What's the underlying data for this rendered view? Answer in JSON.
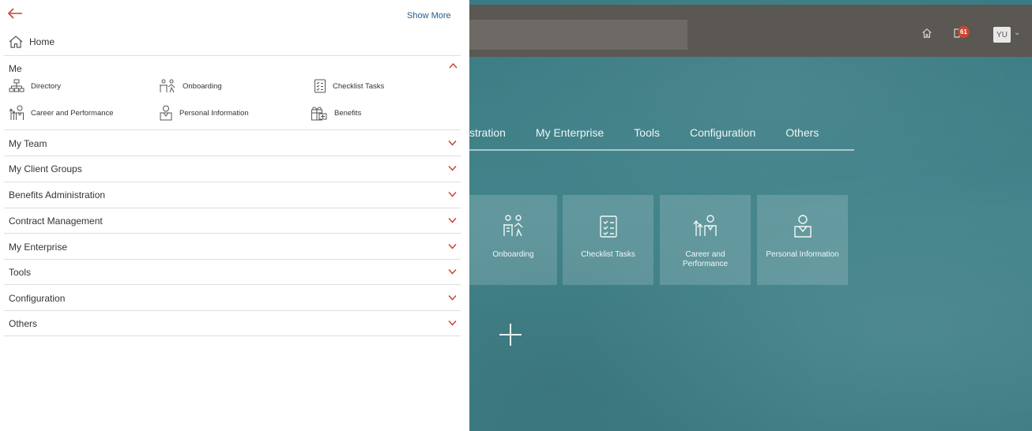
{
  "colors": {
    "accent": "#c74634",
    "link": "#1f5b8c",
    "topbar": "#5b5753",
    "background": "#3f7f86"
  },
  "drawer": {
    "back_icon": "arrow-left-icon",
    "show_more": "Show More",
    "home": {
      "label": "Home",
      "icon": "home-icon"
    },
    "me": {
      "title": "Me",
      "expanded": true,
      "items": [
        {
          "label": "Directory",
          "icon": "org-chart-icon"
        },
        {
          "label": "Onboarding",
          "icon": "onboarding-icon"
        },
        {
          "label": "Checklist Tasks",
          "icon": "checklist-icon"
        },
        {
          "label": "Career and Performance",
          "icon": "career-icon"
        },
        {
          "label": "Personal Information",
          "icon": "person-icon"
        },
        {
          "label": "Benefits",
          "icon": "gift-icon"
        }
      ]
    },
    "sections": [
      {
        "label": "My Team"
      },
      {
        "label": "My Client Groups"
      },
      {
        "label": "Benefits Administration"
      },
      {
        "label": "Contract Management"
      },
      {
        "label": "My Enterprise"
      },
      {
        "label": "Tools"
      },
      {
        "label": "Configuration"
      },
      {
        "label": "Others"
      }
    ]
  },
  "topbar": {
    "notification_count": "61",
    "avatar_initials": "YU"
  },
  "nav_tabs": [
    "stration",
    "My Enterprise",
    "Tools",
    "Configuration",
    "Others"
  ],
  "tiles": [
    {
      "label": "Onboarding",
      "icon": "onboarding-icon"
    },
    {
      "label": "Checklist Tasks",
      "icon": "checklist-icon"
    },
    {
      "label": "Career and Performance",
      "icon": "career-icon"
    },
    {
      "label": "Personal Information",
      "icon": "person-icon"
    }
  ]
}
